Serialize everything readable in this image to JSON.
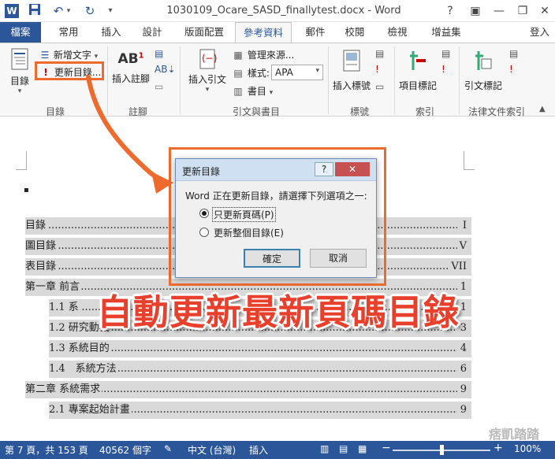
{
  "window": {
    "title": "1030109_Ocare_SASD_finallytest.docx - Word",
    "help": "?",
    "ribbon_options": "▣",
    "minimize": "—",
    "restore": "❐",
    "close": "✕",
    "signin": "登入"
  },
  "tabs": [
    "檔案",
    "常用",
    "插入",
    "設計",
    "版面配置",
    "參考資料",
    "郵件",
    "校閱",
    "檢視",
    "增益集"
  ],
  "ribbon": {
    "toc": {
      "big_label": "目錄",
      "add_text": "新增文字",
      "update_toc": "更新目錄...",
      "group": "目錄"
    },
    "footnotes": {
      "insert_footnote": "插入註腳",
      "ab_icon": "AB",
      "superscript": "1",
      "group": "註腳"
    },
    "citations": {
      "insert_citation": "插入引文",
      "manage_sources": "管理來源...",
      "style_label": "樣式:",
      "style_value": "APA",
      "bibliography": "書目",
      "group": "引文與書目"
    },
    "captions": {
      "insert_caption": "插入標號",
      "group": "標號"
    },
    "index": {
      "mark_entry": "項目標記",
      "group": "索引"
    },
    "authorities": {
      "mark_citation": "引文標記",
      "group": "法律文件索引"
    }
  },
  "document": {
    "bullet": "▪",
    "toc_rows": [
      {
        "label": "目錄",
        "page": "I",
        "indent": false
      },
      {
        "label": "圖目錄",
        "page": "V",
        "indent": false
      },
      {
        "label": "表目錄",
        "page": "VII",
        "indent": false
      },
      {
        "label": "第一章 前言",
        "page": "1",
        "indent": false
      },
      {
        "label": "1.1 系",
        "page": "1",
        "indent": true
      },
      {
        "label": "1.2 研究動機",
        "page": "3",
        "indent": true
      },
      {
        "label": "1.3 系統目的",
        "page": "4",
        "indent": true
      },
      {
        "label": "1.4　系統方法",
        "page": "6",
        "indent": true
      },
      {
        "label": "第二章 系統需求",
        "page": "9",
        "indent": false
      },
      {
        "label": "2.1 專案起始計畫",
        "page": "9",
        "indent": true
      }
    ]
  },
  "dialog": {
    "title": "更新目錄",
    "help": "?",
    "close": "✕",
    "prompt": "Word 正在更新目錄，請選擇下列選項之一:",
    "option_pages": "只更新頁碼(P)",
    "option_entire": "更新整個目錄(E)",
    "ok": "確定",
    "cancel": "取消"
  },
  "banner_text": "自動更新最新頁碼目錄",
  "watermark": "痞凱踏踏",
  "statusbar": {
    "page": "第 7 頁，共 153 頁",
    "words": "40562 個字",
    "language": "中文 (台灣)",
    "mode": "插入",
    "zoom": "100%",
    "zoom_minus": "−",
    "zoom_plus": "+"
  },
  "colors": {
    "word_blue": "#2b579a",
    "highlight_orange": "#ef6a2d",
    "banner_red": "#e8402c"
  }
}
